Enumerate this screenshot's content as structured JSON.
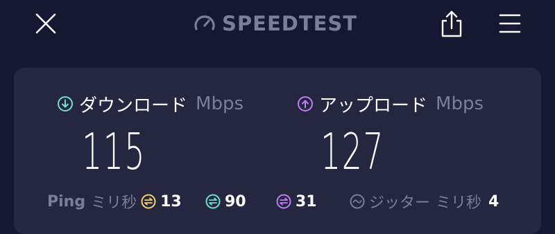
{
  "header": {
    "brand": "SPEEDTEST",
    "icons": [
      "close-icon",
      "gauge-icon",
      "share-icon",
      "menu-icon"
    ]
  },
  "download": {
    "label": "ダウンロード",
    "unit": "Mbps",
    "value": "115",
    "icon": "download-icon",
    "color": "#6fe0d6"
  },
  "upload": {
    "label": "アップロード",
    "unit": "Mbps",
    "value": "127",
    "icon": "upload-icon",
    "color": "#c07ef0"
  },
  "ping": {
    "label": "Ping",
    "unit": "ミリ秒",
    "idle": "13",
    "download": "90",
    "upload": "31",
    "idle_color": "#f5d36a",
    "download_color": "#6fe0d6",
    "upload_color": "#c07ef0"
  },
  "jitter": {
    "label": "ジッター",
    "unit": "ミリ秒",
    "value": "4",
    "icon": "jitter-icon"
  },
  "colors": {
    "background": "#161730",
    "card": "#252740",
    "muted": "#7c7e97"
  }
}
